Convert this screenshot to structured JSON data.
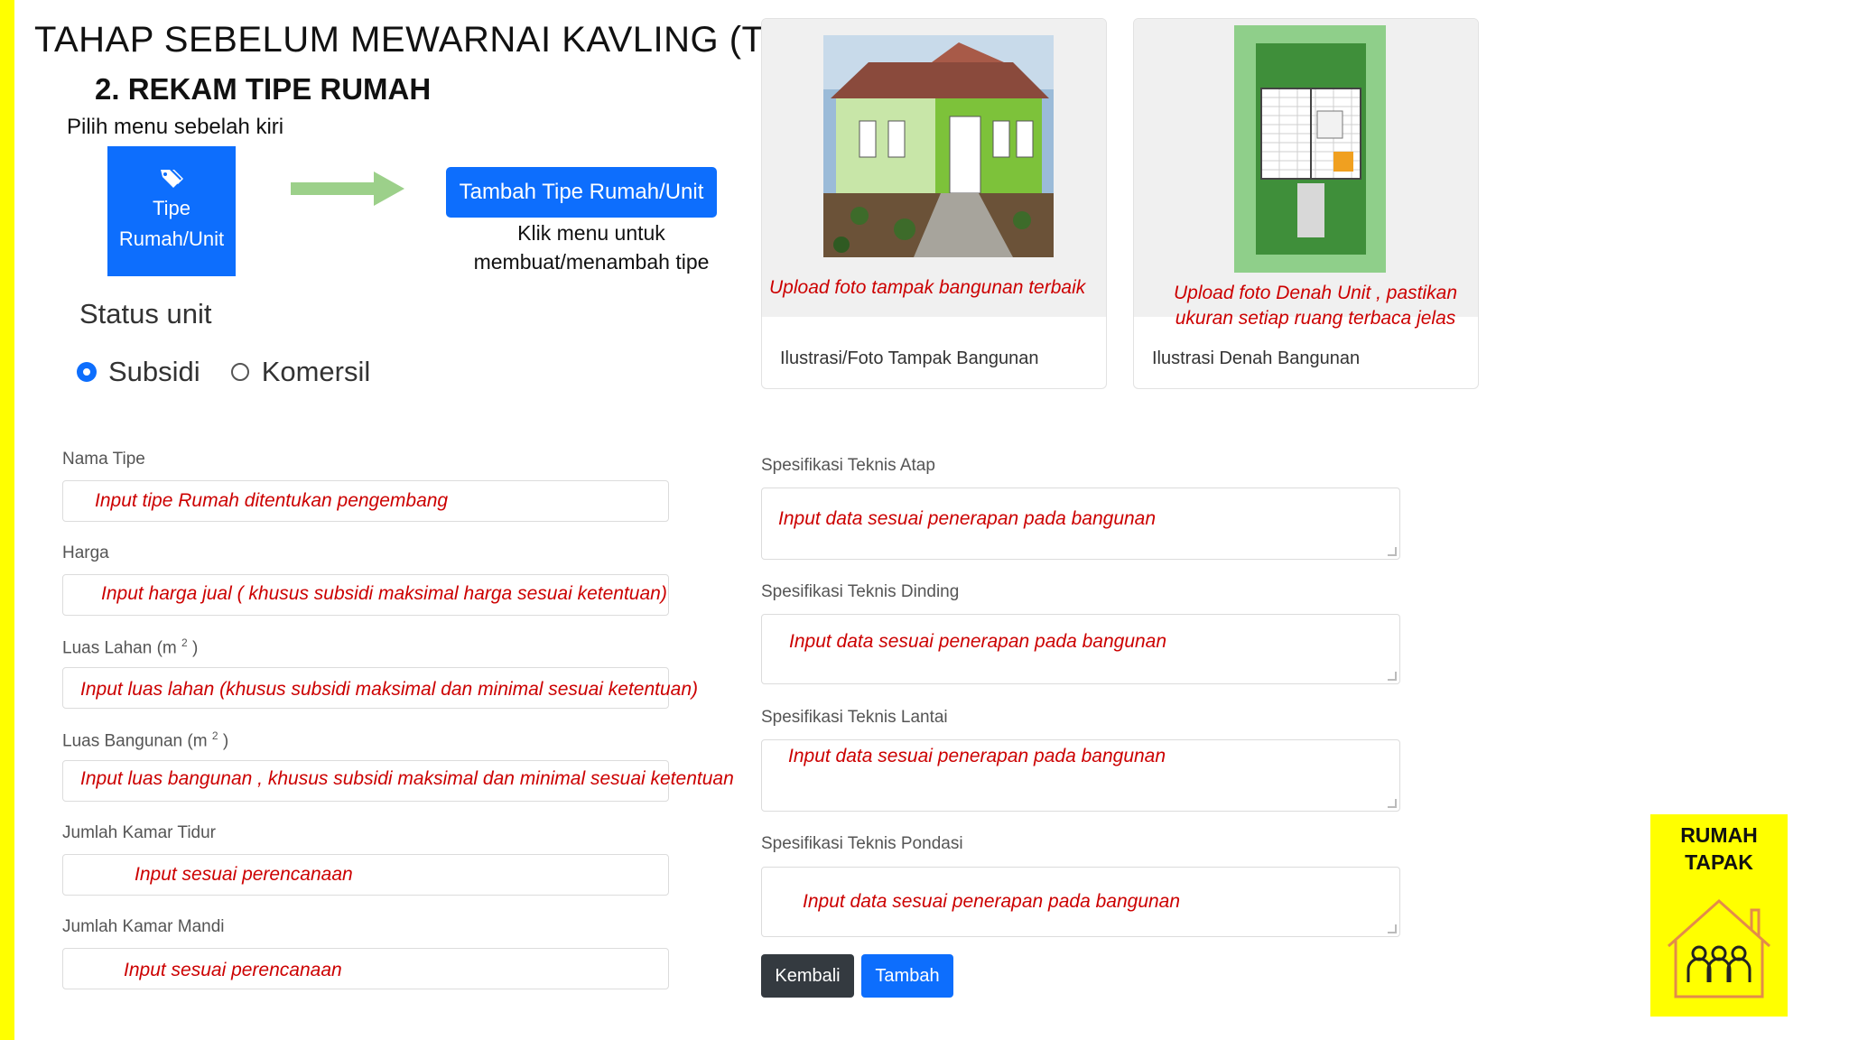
{
  "header": {
    "title": "TAHAP SEBELUM MEWARNAI KAVLING (TAPAK)",
    "subtitle": "2. REKAM TIPE RUMAH",
    "hint": "Pilih menu sebelah kiri"
  },
  "menu_tile": {
    "line1": "Tipe",
    "line2": "Rumah/Unit",
    "icon": "tags-icon"
  },
  "add_type": {
    "button_label": "Tambah Tipe Rumah/Unit",
    "note_line1": "Klik menu untuk",
    "note_line2": "membuat/menambah tipe"
  },
  "status_unit": {
    "label": "Status unit",
    "options": [
      "Subsidi",
      "Komersil"
    ],
    "selected": "Subsidi"
  },
  "cards": {
    "facade": {
      "caption": "Upload foto tampak bangunan terbaik",
      "footer": "Ilustrasi/Foto Tampak Bangunan"
    },
    "floorplan": {
      "caption_line1": "Upload foto Denah Unit , pastikan",
      "caption_line2": "ukuran setiap ruang terbaca jelas",
      "footer": "Ilustrasi Denah Bangunan"
    }
  },
  "left_form": {
    "nama_tipe": {
      "label": "Nama Tipe",
      "value": "Input tipe Rumah ditentukan pengembang"
    },
    "harga": {
      "label": "Harga",
      "value": "Input harga jual ( khusus subsidi maksimal harga sesuai ketentuan)"
    },
    "luas_lahan": {
      "label": "Luas Lahan (m",
      "sup": "2",
      "label_end": ")",
      "value": "Input luas lahan (khusus subsidi maksimal dan minimal sesuai ketentuan)"
    },
    "luas_bangunan": {
      "label": "Luas Bangunan (m",
      "sup": "2",
      "label_end": ")",
      "value": "Input luas bangunan , khusus subsidi maksimal dan minimal sesuai ketentuan"
    },
    "kamar_tidur": {
      "label": "Jumlah Kamar Tidur",
      "value": "Input sesuai perencanaan"
    },
    "kamar_mandi": {
      "label": "Jumlah Kamar Mandi",
      "value": "Input sesuai perencanaan"
    }
  },
  "right_form": {
    "atap": {
      "label": "Spesifikasi Teknis Atap",
      "value": "Input data sesuai penerapan pada bangunan"
    },
    "dinding": {
      "label": "Spesifikasi Teknis Dinding",
      "value": "Input data sesuai penerapan pada bangunan"
    },
    "lantai": {
      "label": "Spesifikasi Teknis Lantai",
      "value": "Input data sesuai penerapan pada bangunan"
    },
    "pondasi": {
      "label": "Spesifikasi Teknis Pondasi",
      "value": "Input data sesuai penerapan pada bangunan"
    }
  },
  "actions": {
    "back": "Kembali",
    "add": "Tambah"
  },
  "badge": {
    "line1": "RUMAH",
    "line2": "TAPAK",
    "icon": "house-people-icon"
  },
  "colors": {
    "primary": "#0d6efd",
    "dark": "#343a40",
    "accent_yellow": "#ffff00",
    "hint_red": "#cc0000",
    "arrow_green": "#9cd08a"
  }
}
